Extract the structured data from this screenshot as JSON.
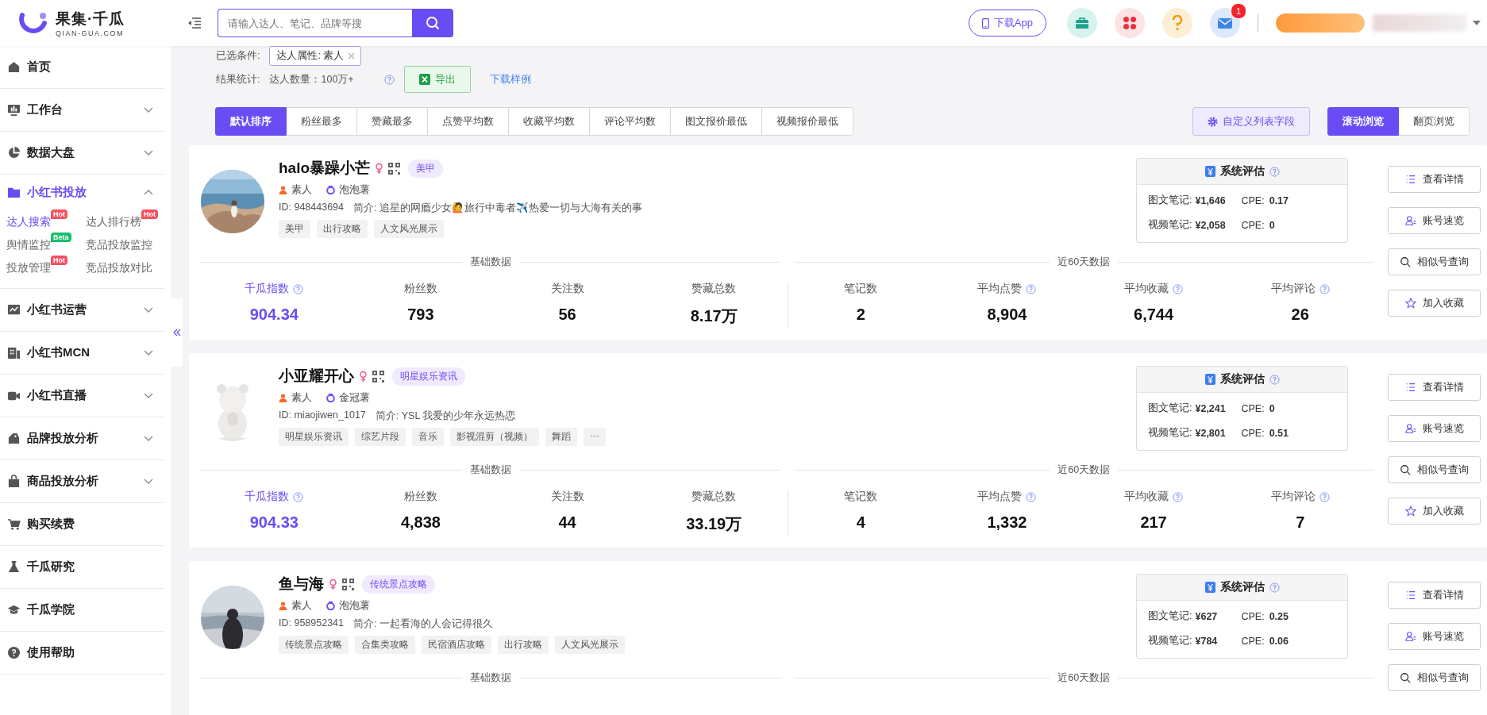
{
  "header": {
    "logo_title": "果集·千瓜",
    "logo_subtitle": "QIAN-GUA.COM",
    "search_placeholder": "请输入达人、笔记、品牌等搜",
    "download_app": "下载App",
    "mail_badge": "1"
  },
  "sidebar": {
    "items": [
      {
        "label": "首页",
        "kind": "home"
      },
      {
        "label": "工作台",
        "kind": "monitor",
        "expanded": false
      },
      {
        "label": "数据大盘",
        "kind": "pie",
        "expanded": false
      },
      {
        "label": "小红书投放",
        "kind": "folder",
        "expanded": true,
        "selected": true,
        "children": [
          {
            "label": "达人搜索",
            "selected": true,
            "badge": {
              "text": "Hot",
              "color": "#f5515f"
            }
          },
          {
            "label": "达人排行榜",
            "selected": false,
            "badge": {
              "text": "Hot",
              "color": "#f5515f"
            }
          },
          {
            "label": "舆情监控",
            "selected": false,
            "badge": {
              "text": "Beta",
              "color": "#19be6b"
            }
          },
          {
            "label": "竞品投放监控",
            "selected": false
          },
          {
            "label": "投放管理",
            "selected": false,
            "badge": {
              "text": "Hot",
              "color": "#f5515f"
            }
          },
          {
            "label": "竞品投放对比",
            "selected": false
          }
        ]
      },
      {
        "label": "小红书运营",
        "kind": "trend",
        "expanded": false
      },
      {
        "label": "小红书MCN",
        "kind": "building",
        "expanded": false
      },
      {
        "label": "小红书直播",
        "kind": "video",
        "expanded": false
      },
      {
        "label": "品牌投放分析",
        "kind": "tag",
        "expanded": false
      },
      {
        "label": "商品投放分析",
        "kind": "bag",
        "expanded": false
      },
      {
        "label": "购买续费",
        "kind": "cart"
      },
      {
        "label": "千瓜研究",
        "kind": "flask"
      },
      {
        "label": "千瓜学院",
        "kind": "cap"
      },
      {
        "label": "使用帮助",
        "kind": "help"
      }
    ]
  },
  "filters": {
    "label": "已选条件:",
    "chips": [
      {
        "text": "达人属性: 素人"
      }
    ]
  },
  "result": {
    "label": "结果统计:",
    "count": "达人数量：100万+",
    "export": "导出",
    "sample": "下载样例"
  },
  "sort_tabs": [
    {
      "label": "默认排序",
      "selected": true
    },
    {
      "label": "粉丝最多",
      "selected": false
    },
    {
      "label": "赞藏最多",
      "selected": false
    },
    {
      "label": "点赞平均数",
      "selected": false
    },
    {
      "label": "收藏平均数",
      "selected": false
    },
    {
      "label": "评论平均数",
      "selected": false
    },
    {
      "label": "图文报价最低",
      "selected": false
    },
    {
      "label": "视频报价最低",
      "selected": false
    }
  ],
  "custom_fields": "自定义列表字段",
  "view_modes": [
    {
      "label": "滚动浏览",
      "selected": true
    },
    {
      "label": "翻页浏览",
      "selected": false
    }
  ],
  "cards": [
    {
      "name": "halo暴躁小芒",
      "category": "美甲",
      "attribute": "素人",
      "level": "泡泡薯",
      "id": "ID: 948443694",
      "bio": "简介: 追星的网瘾少女🙋旅行中毒者✈️热爱一切与大海有关的事",
      "tags": [
        "美甲",
        "出行攻略",
        "人文风光展示"
      ],
      "evaluation": {
        "title": "系统评估",
        "rows": [
          {
            "label": "图文笔记:",
            "price": "¥1,646",
            "cpe_label": "CPE:",
            "cpe": "0.17"
          },
          {
            "label": "视频笔记:",
            "price": "¥2,058",
            "cpe_label": "CPE:",
            "cpe": "0"
          }
        ]
      },
      "sections": [
        "基础数据",
        "近60天数据"
      ],
      "stats": [
        {
          "label": "千瓜指数",
          "value": "904.34",
          "help": true,
          "highlight": true
        },
        {
          "label": "粉丝数",
          "value": "793",
          "help": false,
          "highlight": false
        },
        {
          "label": "关注数",
          "value": "56",
          "help": false,
          "highlight": false
        },
        {
          "label": "赞藏总数",
          "value": "8.17万",
          "help": false,
          "highlight": false
        },
        {
          "label": "笔记数",
          "value": "2",
          "help": false,
          "highlight": false
        },
        {
          "label": "平均点赞",
          "value": "8,904",
          "help": true,
          "highlight": false
        },
        {
          "label": "平均收藏",
          "value": "6,744",
          "help": true,
          "highlight": false
        },
        {
          "label": "平均评论",
          "value": "26",
          "help": true,
          "highlight": false
        }
      ],
      "actions": [
        {
          "label": "查看详情",
          "kind": "list"
        },
        {
          "label": "账号速览",
          "kind": "user"
        },
        {
          "label": "相似号查询",
          "kind": "search"
        },
        {
          "label": "加入收藏",
          "kind": "star"
        }
      ]
    },
    {
      "name": "小亚耀开心",
      "category": "明星娱乐资讯",
      "attribute": "素人",
      "level": "金冠薯",
      "id": "ID: miaojiwen_1017",
      "bio": "简介: YSL 我爱的少年永远热恋",
      "tags": [
        "明星娱乐资讯",
        "综艺片段",
        "音乐",
        "影视混剪（视频）",
        "舞蹈",
        "···"
      ],
      "evaluation": {
        "title": "系统评估",
        "rows": [
          {
            "label": "图文笔记:",
            "price": "¥2,241",
            "cpe_label": "CPE:",
            "cpe": "0"
          },
          {
            "label": "视频笔记:",
            "price": "¥2,801",
            "cpe_label": "CPE:",
            "cpe": "0.51"
          }
        ]
      },
      "sections": [
        "基础数据",
        "近60天数据"
      ],
      "stats": [
        {
          "label": "千瓜指数",
          "value": "904.33",
          "help": true,
          "highlight": true
        },
        {
          "label": "粉丝数",
          "value": "4,838",
          "help": false,
          "highlight": false
        },
        {
          "label": "关注数",
          "value": "44",
          "help": false,
          "highlight": false
        },
        {
          "label": "赞藏总数",
          "value": "33.19万",
          "help": false,
          "highlight": false
        },
        {
          "label": "笔记数",
          "value": "4",
          "help": false,
          "highlight": false
        },
        {
          "label": "平均点赞",
          "value": "1,332",
          "help": true,
          "highlight": false
        },
        {
          "label": "平均收藏",
          "value": "217",
          "help": true,
          "highlight": false
        },
        {
          "label": "平均评论",
          "value": "7",
          "help": true,
          "highlight": false
        }
      ],
      "actions": [
        {
          "label": "查看详情",
          "kind": "list"
        },
        {
          "label": "账号速览",
          "kind": "user"
        },
        {
          "label": "相似号查询",
          "kind": "search"
        },
        {
          "label": "加入收藏",
          "kind": "star"
        }
      ]
    },
    {
      "name": "鱼与海",
      "category": "传统景点攻略",
      "attribute": "素人",
      "level": "泡泡薯",
      "id": "ID: 958952341",
      "bio": "简介: 一起看海的人会记得很久",
      "tags": [
        "传统景点攻略",
        "合集类攻略",
        "民宿酒店攻略",
        "出行攻略",
        "人文风光展示"
      ],
      "evaluation": {
        "title": "系统评估",
        "rows": [
          {
            "label": "图文笔记:",
            "price": "¥627",
            "cpe_label": "CPE:",
            "cpe": "0.25"
          },
          {
            "label": "视频笔记:",
            "price": "¥784",
            "cpe_label": "CPE:",
            "cpe": "0.06"
          }
        ]
      },
      "sections": [
        "基础数据",
        "近60天数据"
      ],
      "actions": [
        {
          "label": "查看详情",
          "kind": "list"
        },
        {
          "label": "账号速览",
          "kind": "user"
        },
        {
          "label": "相似号查询",
          "kind": "search"
        }
      ]
    }
  ]
}
